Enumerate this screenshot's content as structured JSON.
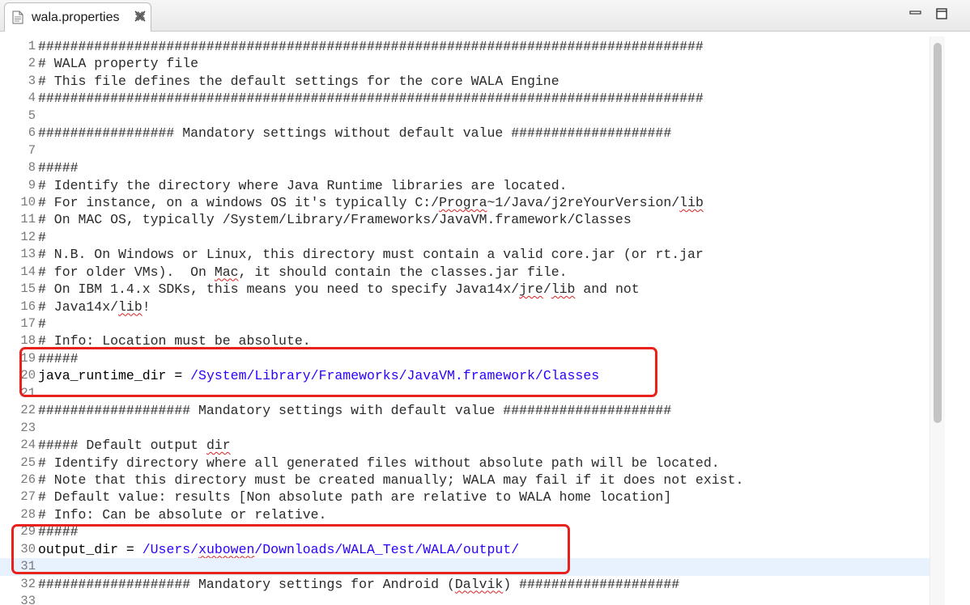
{
  "tab": {
    "title": "wala.properties",
    "icon": "properties-file-icon",
    "close_icon": "close-icon"
  },
  "window_controls": {
    "minimize_icon": "minimize-icon",
    "maximize_icon": "maximize-icon"
  },
  "colors": {
    "comment": "#2a2a2a",
    "value": "#2a00ff",
    "highlight_box": "#e8211c",
    "current_line": "#e8f2fe",
    "spelling_underline": "#d92020"
  },
  "current_line": 31,
  "highlighted_lines": [
    [
      19,
      21
    ],
    [
      29,
      31
    ]
  ],
  "lines": [
    {
      "n": "1",
      "segs": [
        {
          "t": "###################################################################################"
        }
      ]
    },
    {
      "n": "2",
      "segs": [
        {
          "t": "# WALA property file"
        }
      ]
    },
    {
      "n": "3",
      "segs": [
        {
          "t": "# This file defines the default settings for the core WALA Engine"
        }
      ]
    },
    {
      "n": "4",
      "segs": [
        {
          "t": "###################################################################################"
        }
      ]
    },
    {
      "n": "5",
      "segs": []
    },
    {
      "n": "6",
      "segs": [
        {
          "t": "################# Mandatory settings without default value ####################"
        }
      ]
    },
    {
      "n": "7",
      "segs": []
    },
    {
      "n": "8",
      "segs": [
        {
          "t": "#####"
        }
      ]
    },
    {
      "n": "9",
      "segs": [
        {
          "t": "# Identify the directory where Java Runtime libraries are located."
        }
      ]
    },
    {
      "n": "10",
      "segs": [
        {
          "t": "# For instance, on a windows OS it's typically C:/"
        },
        {
          "t": "Progra",
          "s": 1
        },
        {
          "t": "~1/Java/j2reYourVersion/"
        },
        {
          "t": "lib",
          "s": 1
        }
      ]
    },
    {
      "n": "11",
      "segs": [
        {
          "t": "# On MAC OS, typically /System/Library/Frameworks/JavaVM.framework/Classes"
        }
      ]
    },
    {
      "n": "12",
      "segs": [
        {
          "t": "#"
        }
      ]
    },
    {
      "n": "13",
      "segs": [
        {
          "t": "# N.B. On Windows or Linux, this directory must contain a valid core.jar (or rt.jar"
        }
      ]
    },
    {
      "n": "14",
      "segs": [
        {
          "t": "# for older VMs).  On "
        },
        {
          "t": "Mac",
          "s": 1
        },
        {
          "t": ", it should contain the classes.jar file."
        }
      ]
    },
    {
      "n": "15",
      "segs": [
        {
          "t": "# On IBM 1.4.x SDKs, this means you need to specify Java14x/"
        },
        {
          "t": "jre",
          "s": 1
        },
        {
          "t": "/"
        },
        {
          "t": "lib",
          "s": 1
        },
        {
          "t": " and not"
        }
      ]
    },
    {
      "n": "16",
      "segs": [
        {
          "t": "# Java14x/"
        },
        {
          "t": "lib",
          "s": 1
        },
        {
          "t": "!"
        }
      ]
    },
    {
      "n": "17",
      "segs": [
        {
          "t": "#"
        }
      ]
    },
    {
      "n": "18",
      "segs": [
        {
          "t": "# Info: Location must be absolute."
        }
      ]
    },
    {
      "n": "19",
      "segs": [
        {
          "t": "#####"
        }
      ]
    },
    {
      "n": "20",
      "segs": [
        {
          "t": "java_runtime_dir",
          "k": 1
        },
        {
          "t": " = ",
          "k": 1
        },
        {
          "t": "/System/Library/Frameworks/JavaVM.framework/Classes",
          "v": 1
        }
      ]
    },
    {
      "n": "21",
      "segs": []
    },
    {
      "n": "22",
      "segs": [
        {
          "t": "################### Mandatory settings with default value #####################"
        }
      ]
    },
    {
      "n": "23",
      "segs": []
    },
    {
      "n": "24",
      "segs": [
        {
          "t": "##### Default output "
        },
        {
          "t": "dir",
          "s": 1
        }
      ]
    },
    {
      "n": "25",
      "segs": [
        {
          "t": "# Identify directory where all generated files without absolute path will be located."
        }
      ]
    },
    {
      "n": "26",
      "segs": [
        {
          "t": "# Note that this directory must be created manually; WALA may fail if it does not exist."
        }
      ]
    },
    {
      "n": "27",
      "segs": [
        {
          "t": "# Default value: results [Non absolute path are relative to WALA home location]"
        }
      ]
    },
    {
      "n": "28",
      "segs": [
        {
          "t": "# Info: Can be absolute or relative."
        }
      ]
    },
    {
      "n": "29",
      "segs": [
        {
          "t": "#####"
        }
      ]
    },
    {
      "n": "30",
      "segs": [
        {
          "t": "output_dir",
          "k": 1
        },
        {
          "t": " = ",
          "k": 1
        },
        {
          "t": "/Users/",
          "v": 1
        },
        {
          "t": "xubowen",
          "v": 1,
          "s": 1
        },
        {
          "t": "/Downloads/WALA_Test/WALA/output/",
          "v": 1
        }
      ]
    },
    {
      "n": "31",
      "segs": []
    },
    {
      "n": "32",
      "segs": [
        {
          "t": "################### Mandatory settings for Android ("
        },
        {
          "t": "Dalvik",
          "s": 1
        },
        {
          "t": ") ####################"
        }
      ]
    },
    {
      "n": "33",
      "segs": []
    }
  ]
}
